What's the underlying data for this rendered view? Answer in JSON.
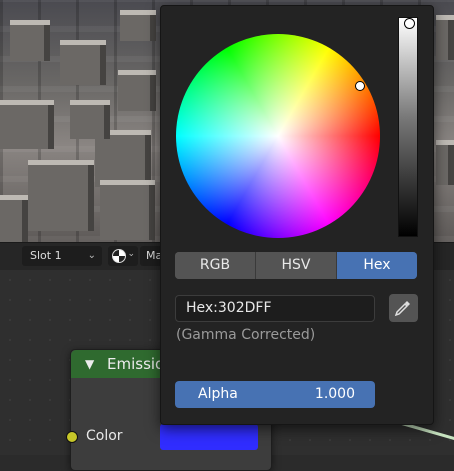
{
  "viewport_header": {
    "slot_label": "Slot 1",
    "material_label": "Ma"
  },
  "color_picker": {
    "tabs": [
      {
        "label": "RGB",
        "active": false
      },
      {
        "label": "HSV",
        "active": false
      },
      {
        "label": "Hex",
        "active": true
      }
    ],
    "hex_value": "Hex:302DFF",
    "gamma_note": "(Gamma Corrected)",
    "alpha_label": "Alpha",
    "alpha_value": "1.000",
    "eyedropper_icon": "eyedropper-icon"
  },
  "node": {
    "title": "Emissio",
    "socket_label": "Color",
    "color_hex": "#302DFF",
    "header_color": "#2F6A2F"
  },
  "colors": {
    "accent": "#4772B3",
    "socket_yellow": "#C7C729"
  }
}
